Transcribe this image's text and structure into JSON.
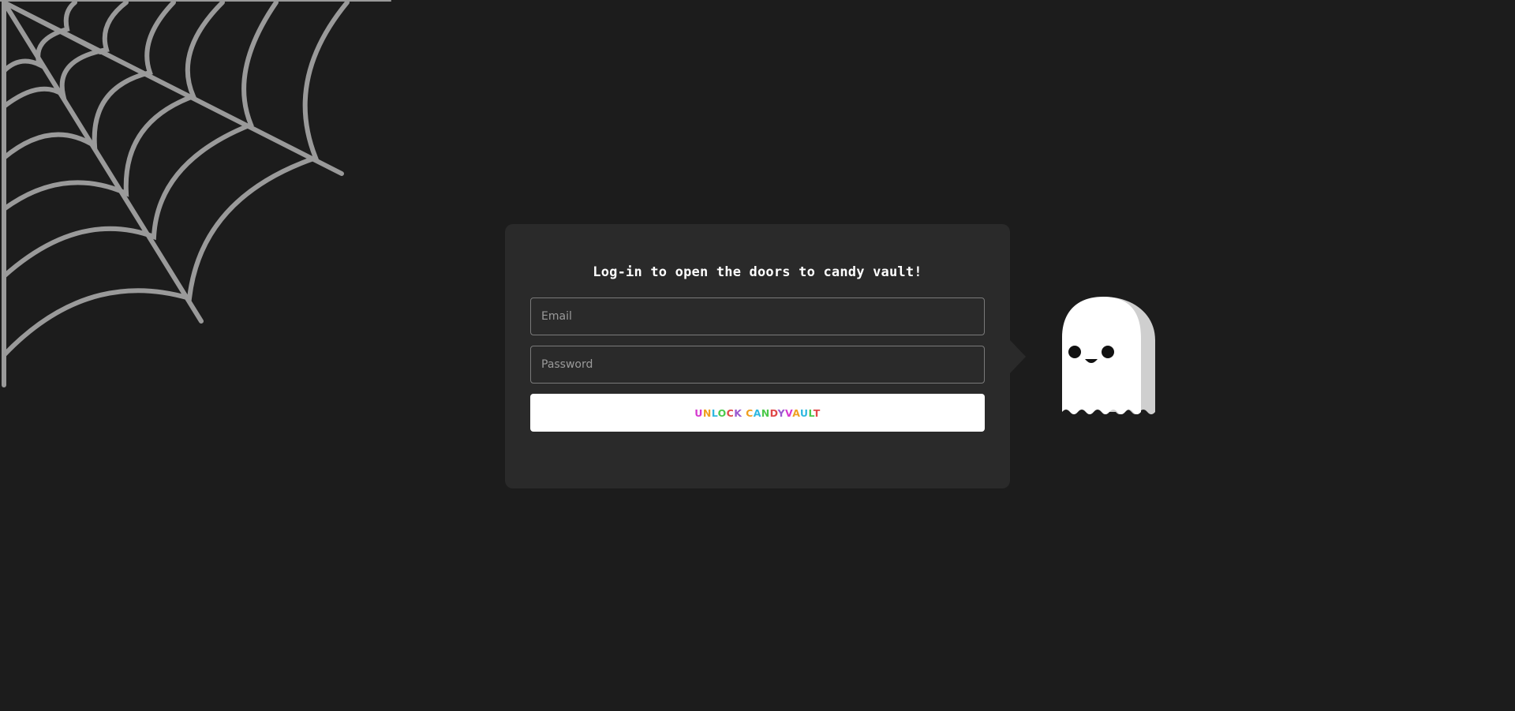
{
  "login": {
    "heading": "Log-in to open the doors to candy vault!",
    "email_placeholder": "Email",
    "password_placeholder": "Password",
    "button_letters": [
      "U",
      "N",
      "L",
      "O",
      "C",
      "K",
      " ",
      "C",
      "A",
      "N",
      "D",
      "Y",
      "V",
      "A",
      "U",
      "L",
      "T"
    ]
  },
  "colors": {
    "background": "#1c1c1c",
    "card": "#2a2a2a",
    "web": "#9a9a9a",
    "button_letter_palette": [
      "#d63ad0",
      "#f0a020",
      "#2fb8e0",
      "#4cc94c",
      "#e04848",
      "#9b59d0"
    ]
  },
  "icons": [
    "spider-web-icon",
    "ghost-icon"
  ]
}
